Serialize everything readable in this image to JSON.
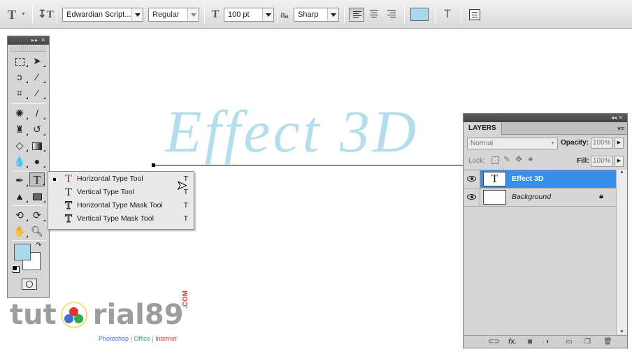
{
  "options_bar": {
    "font_family": "Edwardian Script...",
    "font_style": "Regular",
    "font_size": "100 pt",
    "antialias_label": "aₐ",
    "antialias": "Sharp",
    "text_color": "#a9d9ea"
  },
  "tools_panel": {
    "header_glyphs": "▸▸ ✕"
  },
  "type_flyout": {
    "items": [
      {
        "label": "Horizontal Type Tool",
        "key": "T",
        "icon": "T",
        "selected": true
      },
      {
        "label": "Vertical Type Tool",
        "key": "T",
        "icon": "T",
        "selected": false
      },
      {
        "label": "Horizontal Type Mask Tool",
        "key": "T",
        "icon": "T",
        "selected": false
      },
      {
        "label": "Vertical Type Mask Tool",
        "key": "T",
        "icon": "T",
        "selected": false
      }
    ]
  },
  "canvas": {
    "text": "Effect 3D"
  },
  "layers_panel": {
    "tab": "LAYERS",
    "blend_mode": "Normal",
    "opacity_label": "Opacity:",
    "opacity": "100%",
    "lock_label": "Lock:",
    "fill_label": "Fill:",
    "fill": "100%",
    "layers": [
      {
        "name": "Effect 3D",
        "thumb": "T",
        "active": true
      },
      {
        "name": "Background",
        "thumb": "",
        "active": false,
        "locked": true
      }
    ]
  },
  "watermark": {
    "text_left": "tut",
    "text_right": "rial89",
    "suffix": ".COM",
    "tag1": "Photoshop",
    "tag2": "Office",
    "tag3": "Internet",
    "divider": "|"
  }
}
